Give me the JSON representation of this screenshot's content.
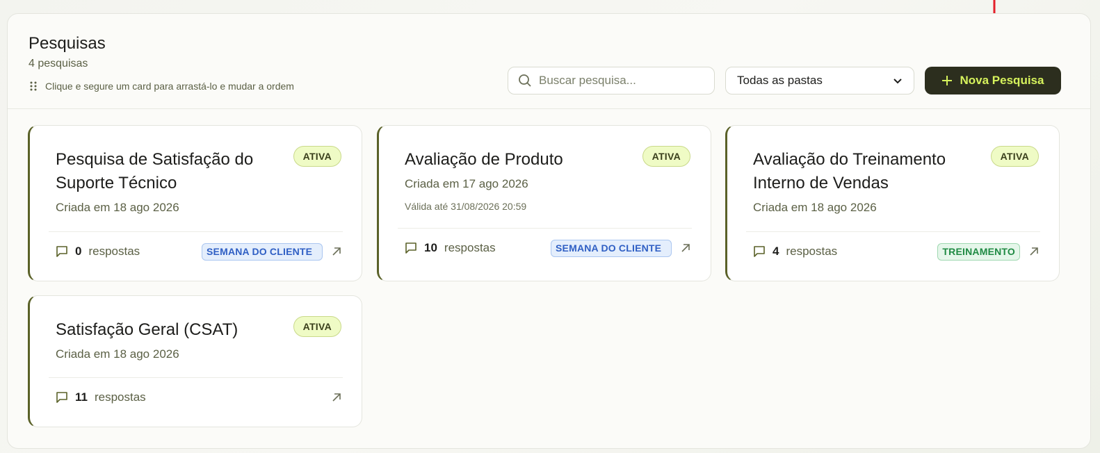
{
  "header": {
    "title": "Pesquisas",
    "count": "4 pesquisas",
    "hint": "Clique e segure um card para arrastá-lo e mudar a ordem"
  },
  "search": {
    "placeholder": "Buscar pesquisa..."
  },
  "folder_select": {
    "value": "Todas as pastas"
  },
  "new_button": {
    "label": "Nova Pesquisa"
  },
  "responses_label": "respostas",
  "colors": {
    "accent_dark": "#2c2e1e",
    "accent_lime": "#d6f25c",
    "card_border_left": "#5a6128",
    "status_bg": "#effbc5"
  },
  "cards": [
    {
      "title": "Pesquisa de Satisfação do Suporte Técnico",
      "status": "ATIVA",
      "created": "Criada em 18 ago 2026",
      "valid": "",
      "responses": "0",
      "tag": "SEMANA DO CLIENTE",
      "tag_color": "blue"
    },
    {
      "title": "Avaliação de Produto",
      "status": "ATIVA",
      "created": "Criada em 17 ago 2026",
      "valid": "Válida até 31/08/2026 20:59",
      "responses": "10",
      "tag": "SEMANA DO CLIENTE",
      "tag_color": "blue"
    },
    {
      "title": "Avaliação do Treinamento Interno de Vendas",
      "status": "ATIVA",
      "created": "Criada em 18 ago 2026",
      "valid": "",
      "responses": "4",
      "tag": "TREINAMENTO",
      "tag_color": "green"
    },
    {
      "title": "Satisfação Geral (CSAT)",
      "status": "ATIVA",
      "created": "Criada em 18 ago 2026",
      "valid": "",
      "responses": "11",
      "tag": "",
      "tag_color": ""
    }
  ]
}
